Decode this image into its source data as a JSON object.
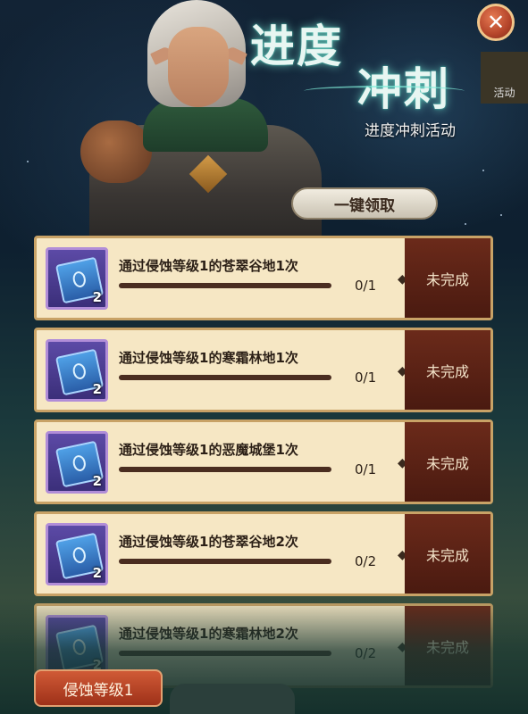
{
  "header": {
    "title_line1": "进度",
    "title_line2": "冲刺",
    "subtitle": "进度冲刺活动",
    "side_tab_label": "活动",
    "close_glyph": "✕"
  },
  "claim_all_label": "一键领取",
  "tasks": [
    {
      "label": "通过侵蚀等级1的苍翠谷地1次",
      "reward_count": "2",
      "progress_text": "0/1",
      "progress": 0,
      "status": "未完成"
    },
    {
      "label": "通过侵蚀等级1的寒霜林地1次",
      "reward_count": "2",
      "progress_text": "0/1",
      "progress": 0,
      "status": "未完成"
    },
    {
      "label": "通过侵蚀等级1的恶魔城堡1次",
      "reward_count": "2",
      "progress_text": "0/1",
      "progress": 0,
      "status": "未完成"
    },
    {
      "label": "通过侵蚀等级1的苍翠谷地2次",
      "reward_count": "2",
      "progress_text": "0/2",
      "progress": 0,
      "status": "未完成"
    },
    {
      "label": "通过侵蚀等级1的寒霜林地2次",
      "reward_count": "2",
      "progress_text": "0/2",
      "progress": 0,
      "status": "未完成"
    }
  ],
  "tier_button_label": "侵蚀等级1",
  "icons": {
    "reward": "scroll-icon",
    "close": "close-icon",
    "separator": "diamond-icon"
  },
  "colors": {
    "status_bg": "#5a2214",
    "card_bg": "#f6e7c4",
    "title_glow": "#3dc7b6"
  }
}
